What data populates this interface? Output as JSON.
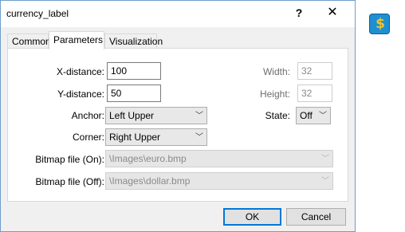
{
  "window": {
    "title": "currency_label",
    "help_glyph": "?",
    "close_glyph": "✕"
  },
  "tabs": [
    {
      "label": "Common"
    },
    {
      "label": "Parameters"
    },
    {
      "label": "Visualization"
    }
  ],
  "fields": {
    "x_distance": {
      "label": "X-distance:",
      "value": "100"
    },
    "y_distance": {
      "label": "Y-distance:",
      "value": "50"
    },
    "width": {
      "label": "Width:",
      "value": "32"
    },
    "height": {
      "label": "Height:",
      "value": "32"
    },
    "anchor": {
      "label": "Anchor:",
      "value": "Left Upper"
    },
    "corner": {
      "label": "Corner:",
      "value": "Right Upper"
    },
    "state": {
      "label": "State:",
      "value": "Off"
    },
    "bitmap_on": {
      "label": "Bitmap file (On):",
      "value": "\\Images\\euro.bmp"
    },
    "bitmap_off": {
      "label": "Bitmap file (Off):",
      "value": "\\Images\\dollar.bmp"
    }
  },
  "buttons": {
    "ok": "OK",
    "cancel": "Cancel"
  },
  "icons": {
    "dropdown": "chevron-down-icon",
    "app": "dollar-coin-icon",
    "dropdown_glyph": "﹀",
    "app_glyph": "$"
  }
}
